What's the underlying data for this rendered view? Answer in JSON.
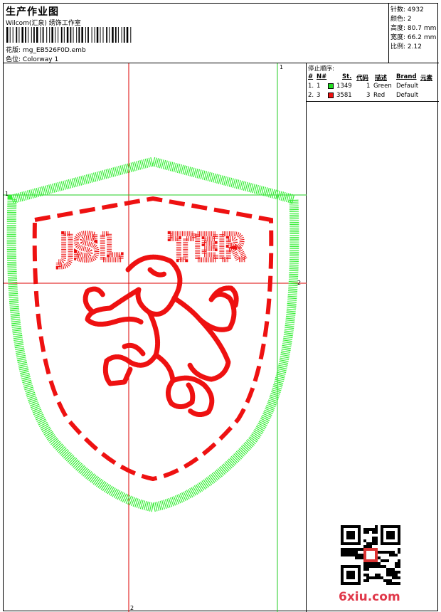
{
  "header": {
    "title": "生产作业图",
    "subtitle": "Wilcom(汇泉) 绣饰工作室",
    "pattern_label": "花版:",
    "pattern_value": "mg_EB526F0D.emb",
    "colorway_label": "色位:",
    "colorway_value": "Colorway 1"
  },
  "stats": {
    "stitches_label": "针数:",
    "stitches_value": "4932",
    "colors_label": "颜色:",
    "colors_value": "2",
    "height_label": "高度:",
    "height_value": "80.7 mm",
    "width_label": "宽度:",
    "width_value": "66.2 mm",
    "scale_label": "比例:",
    "scale_value": "2.12"
  },
  "stop_sequence": {
    "caption": "停止顺序:",
    "columns": [
      "#",
      "N#",
      "St.",
      "代码",
      "描述",
      "Brand",
      "元素"
    ],
    "rows": [
      {
        "index": "1.",
        "needle": "1",
        "stitches": "1349",
        "code": "1",
        "description": "Green",
        "brand": "Default",
        "color": "#22dd22"
      },
      {
        "index": "2.",
        "needle": "3",
        "stitches": "3581",
        "code": "3",
        "description": "Red",
        "brand": "Default",
        "color": "#ee1111"
      }
    ]
  },
  "design": {
    "text_top": "JSL",
    "text_right": "TER",
    "outline_color": "#33ee33",
    "fill_color": "#ee1111",
    "guide_color": "#22cc22",
    "guide_color_red": "#dd0000",
    "marks": {
      "m1": "1",
      "m2": "2",
      "m3": "1",
      "m4": "2"
    }
  },
  "watermark": {
    "site": "6xiu.com",
    "qr_icon": "qr-code-icon"
  }
}
